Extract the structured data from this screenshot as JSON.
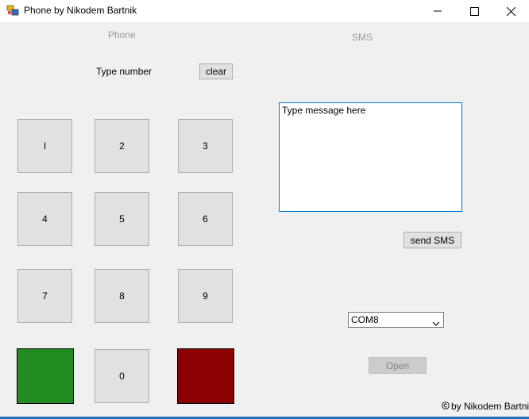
{
  "window": {
    "title": "Phone by Nikodem Bartnik"
  },
  "phone": {
    "section_label": "Phone",
    "number_label": "Type number",
    "clear_label": "clear",
    "keys": [
      "I",
      "2",
      "3",
      "4",
      "5",
      "6",
      "7",
      "8",
      "9",
      "0"
    ],
    "call_color": "#228b22",
    "hangup_color": "#8b0000"
  },
  "sms": {
    "section_label": "SMS",
    "message_text": "Type message here",
    "send_label": "send SMS"
  },
  "port": {
    "selected": "COM8",
    "open_label": "Open"
  },
  "footer": {
    "credit": "by Nikodem Bartnik"
  },
  "icons": {
    "app": "app-icon",
    "minimize": "minimize-icon",
    "maximize": "maximize-icon",
    "close": "close-icon",
    "dropdown": "chevron-down-icon",
    "copyright": "copyright-icon"
  }
}
